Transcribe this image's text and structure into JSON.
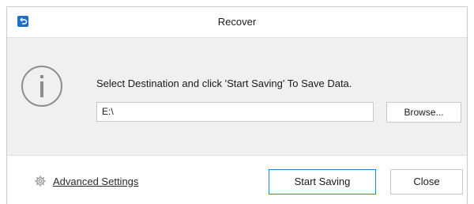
{
  "window": {
    "title": "Recover"
  },
  "dialog": {
    "message": "Select Destination and click 'Start Saving' To Save Data.",
    "path_value": "E:\\",
    "browse_label": "Browse..."
  },
  "footer": {
    "advanced_label": "Advanced Settings",
    "start_label": "Start Saving",
    "close_label": "Close"
  },
  "icons": {
    "app": "undo-arrow-icon",
    "info": "info-icon",
    "gear": "gear-icon"
  },
  "colors": {
    "accent": "#1f6fc8",
    "content_bg": "#f0f0f0",
    "default_button_border": "#2d7fd6"
  }
}
